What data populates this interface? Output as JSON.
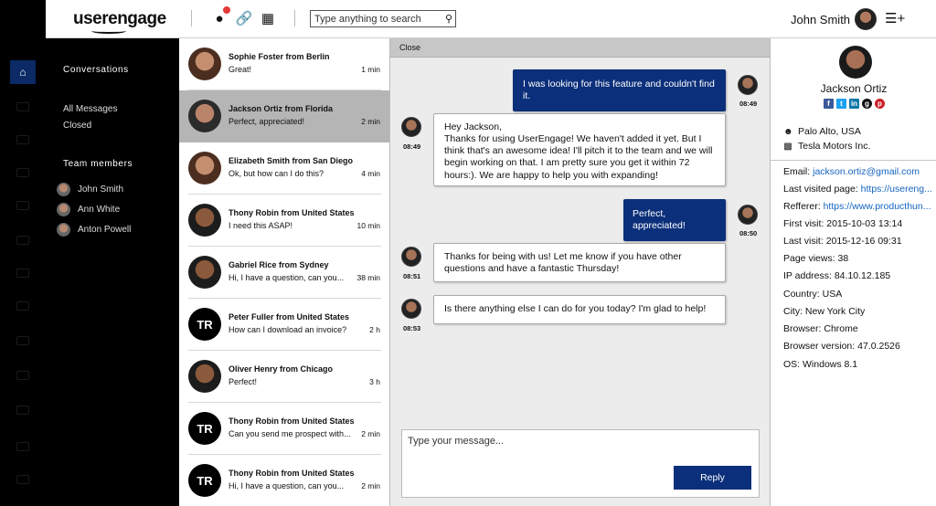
{
  "header": {
    "logo": "userengage",
    "search_placeholder": "Type anything to search",
    "user_name": "John Smith"
  },
  "sidebar": {
    "conversations_heading": "Conversations",
    "links": [
      "All Messages",
      "Closed"
    ],
    "team_heading": "Team members",
    "team": [
      "John Smith",
      "Ann White",
      "Anton Powell"
    ]
  },
  "conversations": [
    {
      "name": "Sophie Foster from Berlin",
      "message": "Great!",
      "time": "1 min",
      "avatar": "photo"
    },
    {
      "name": "Jackson Ortiz from Florida",
      "message": "Perfect, appreciated!",
      "time": "2 min",
      "avatar": "photo",
      "active": true
    },
    {
      "name": "Elizabeth Smith from San Diego",
      "message": "Ok, but how can I do this?",
      "time": "4 min",
      "avatar": "photo"
    },
    {
      "name": "Thony Robin from United States",
      "message": "I need this ASAP!",
      "time": "10 min",
      "avatar": "photo"
    },
    {
      "name": "Gabriel Rice from Sydney",
      "message": "Hi, I have a question, can you...",
      "time": "38 min",
      "avatar": "photo"
    },
    {
      "name": "Peter Fuller from United States",
      "message": "How can I download an invoice?",
      "time": "2 h",
      "avatar": "TR"
    },
    {
      "name": "Oliver Henry from Chicago",
      "message": "Perfect!",
      "time": "3 h",
      "avatar": "photo"
    },
    {
      "name": "Thony Robin from United States",
      "message": "Can you send me prospect with...",
      "time": "2 min",
      "avatar": "TR"
    },
    {
      "name": "Thony Robin from United States",
      "message": "Hi, I have a question, can you...",
      "time": "2 min",
      "avatar": "TR"
    }
  ],
  "chat": {
    "close_label": "Close",
    "messages": [
      {
        "dir": "out",
        "text": "I was looking for this feature and couldn't find it.",
        "time": "08:49"
      },
      {
        "dir": "in",
        "text": "Hey Jackson,\nThanks for using UserEngage! We haven't added it yet. But I think that's an awesome idea! I'll pitch it to the team and we will begin working on that. I am pretty sure you get it within 72 hours:). We are happy to help you with expanding!",
        "time": "08:49"
      },
      {
        "dir": "out",
        "text": "Perfect, appreciated!",
        "time": "08:50"
      },
      {
        "dir": "in",
        "text": "Thanks for being with us! Let me know if you have other questions and have a fantastic Thursday!",
        "time": "08:51"
      },
      {
        "dir": "in",
        "text": "Is there anything else I can do for you today? I'm glad to help!",
        "time": "08:53"
      }
    ],
    "composer_placeholder": "Type your message...",
    "reply_label": "Reply"
  },
  "profile": {
    "name": "Jackson Ortiz",
    "location": "Palo Alto, USA",
    "company": "Tesla Motors Inc.",
    "fields": [
      {
        "label": "Email:",
        "value": "jackson.ortiz@gmail.com",
        "link": true
      },
      {
        "label": "Last visited page:",
        "value": "https://usereng...",
        "link": true
      },
      {
        "label": "Refferer:",
        "value": "https://www.producthun...",
        "link": true
      },
      {
        "label": "First visit:",
        "value": "2015-10-03 13:14",
        "link": false
      },
      {
        "label": "Last visit:",
        "value": "2015-12-16 09:31",
        "link": false
      },
      {
        "label": "Page views:",
        "value": "38",
        "link": false
      },
      {
        "label": "IP address:",
        "value": "84.10.12.185",
        "link": false
      },
      {
        "label": "Country:",
        "value": "USA",
        "link": false
      },
      {
        "label": "City:",
        "value": "New York City",
        "link": false
      },
      {
        "label": "Browser:",
        "value": "Chrome",
        "link": false
      },
      {
        "label": "Browser version:",
        "value": "47.0.2526",
        "link": false
      },
      {
        "label": "OS:",
        "value": "Windows 8.1",
        "link": false
      }
    ],
    "socials": [
      {
        "icon": "facebook-icon",
        "glyph": "f",
        "color": "#3b5998"
      },
      {
        "icon": "twitter-icon",
        "glyph": "t",
        "color": "#1da1f2"
      },
      {
        "icon": "linkedin-icon",
        "glyph": "in",
        "color": "#0e76a8"
      },
      {
        "icon": "github-icon",
        "glyph": "g",
        "color": "#111111"
      },
      {
        "icon": "pinterest-icon",
        "glyph": "p",
        "color": "#cb2027"
      }
    ]
  },
  "colors": {
    "accent": "#0b2f7a",
    "nav_active": "#0b2a66",
    "link": "#1565c0"
  }
}
